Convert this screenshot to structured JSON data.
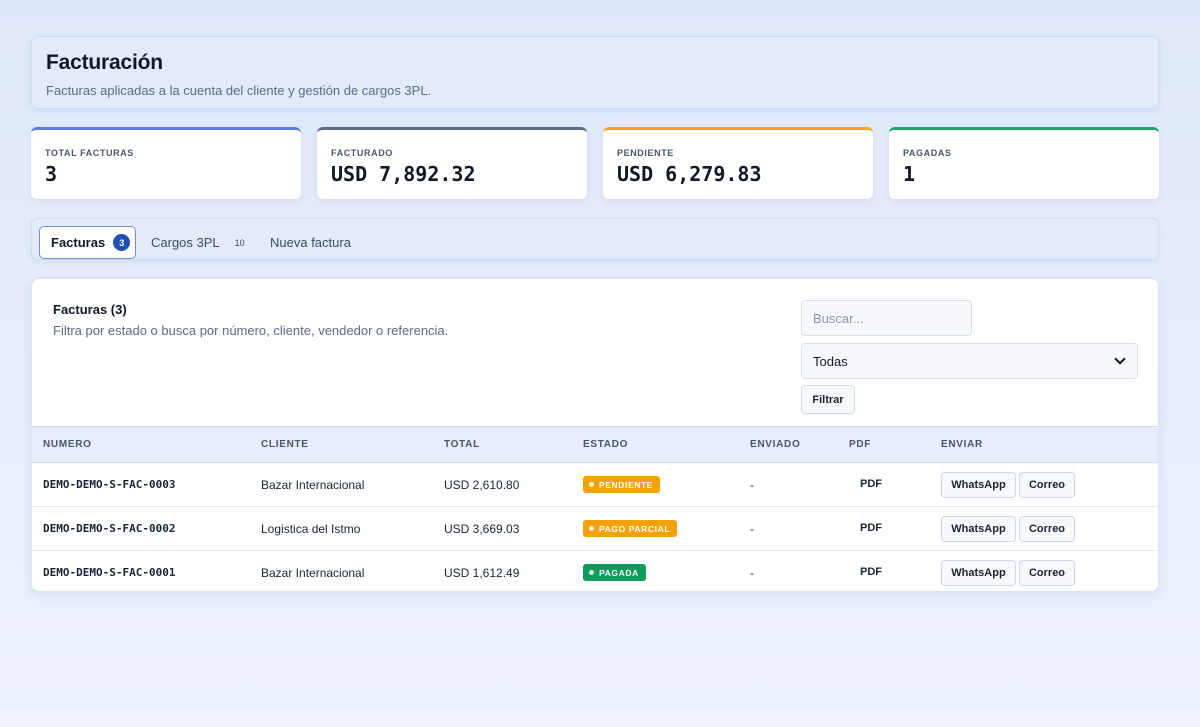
{
  "header": {
    "title": "Facturación",
    "subtitle": "Facturas aplicadas a la cuenta del cliente y gestión de cargos 3PL."
  },
  "stats": [
    {
      "label": "TOTAL FACTURAS",
      "value": "3",
      "accent": "#5b7fd6"
    },
    {
      "label": "FACTURADO",
      "value": "USD 7,892.32",
      "accent": "#5c6a87"
    },
    {
      "label": "PENDIENTE",
      "value": "USD 6,279.83",
      "accent": "#f5a623"
    },
    {
      "label": "PAGADAS",
      "value": "1",
      "accent": "#1fa36a"
    }
  ],
  "tabs": [
    {
      "label": "Facturas",
      "badge": "3",
      "active": true
    },
    {
      "label": "Cargos 3PL",
      "badge": "10",
      "active": false
    },
    {
      "label": "Nueva factura",
      "badge": "",
      "active": false
    }
  ],
  "list": {
    "title": "Facturas (3)",
    "subtitle": "Filtra por estado o busca por número, cliente, vendedor o referencia.",
    "search_placeholder": "Buscar...",
    "search_value": "",
    "status_filter": "Todas",
    "filter_label": "Filtrar"
  },
  "table": {
    "columns": [
      "NUMERO",
      "CLIENTE",
      "TOTAL",
      "ESTADO",
      "ENVIADO",
      "PDF",
      "ENVIAR"
    ],
    "rows": [
      {
        "numero": "DEMO-DEMO-S-FAC-0003",
        "cliente": "Bazar Internacional",
        "total": "USD 2,610.80",
        "estado": "PENDIENTE",
        "estado_color": "#f5a20a",
        "enviado": "-",
        "pdf": "PDF",
        "whatsapp": "WhatsApp",
        "correo": "Correo"
      },
      {
        "numero": "DEMO-DEMO-S-FAC-0002",
        "cliente": "Logistica del Istmo",
        "total": "USD 3,669.03",
        "estado": "PAGO PARCIAL",
        "estado_color": "#f5a20a",
        "enviado": "-",
        "pdf": "PDF",
        "whatsapp": "WhatsApp",
        "correo": "Correo"
      },
      {
        "numero": "DEMO-DEMO-S-FAC-0001",
        "cliente": "Bazar Internacional",
        "total": "USD 1,612.49",
        "estado": "PAGADA",
        "estado_color": "#0e9a5a",
        "enviado": "-",
        "pdf": "PDF",
        "whatsapp": "WhatsApp",
        "correo": "Correo"
      }
    ]
  }
}
